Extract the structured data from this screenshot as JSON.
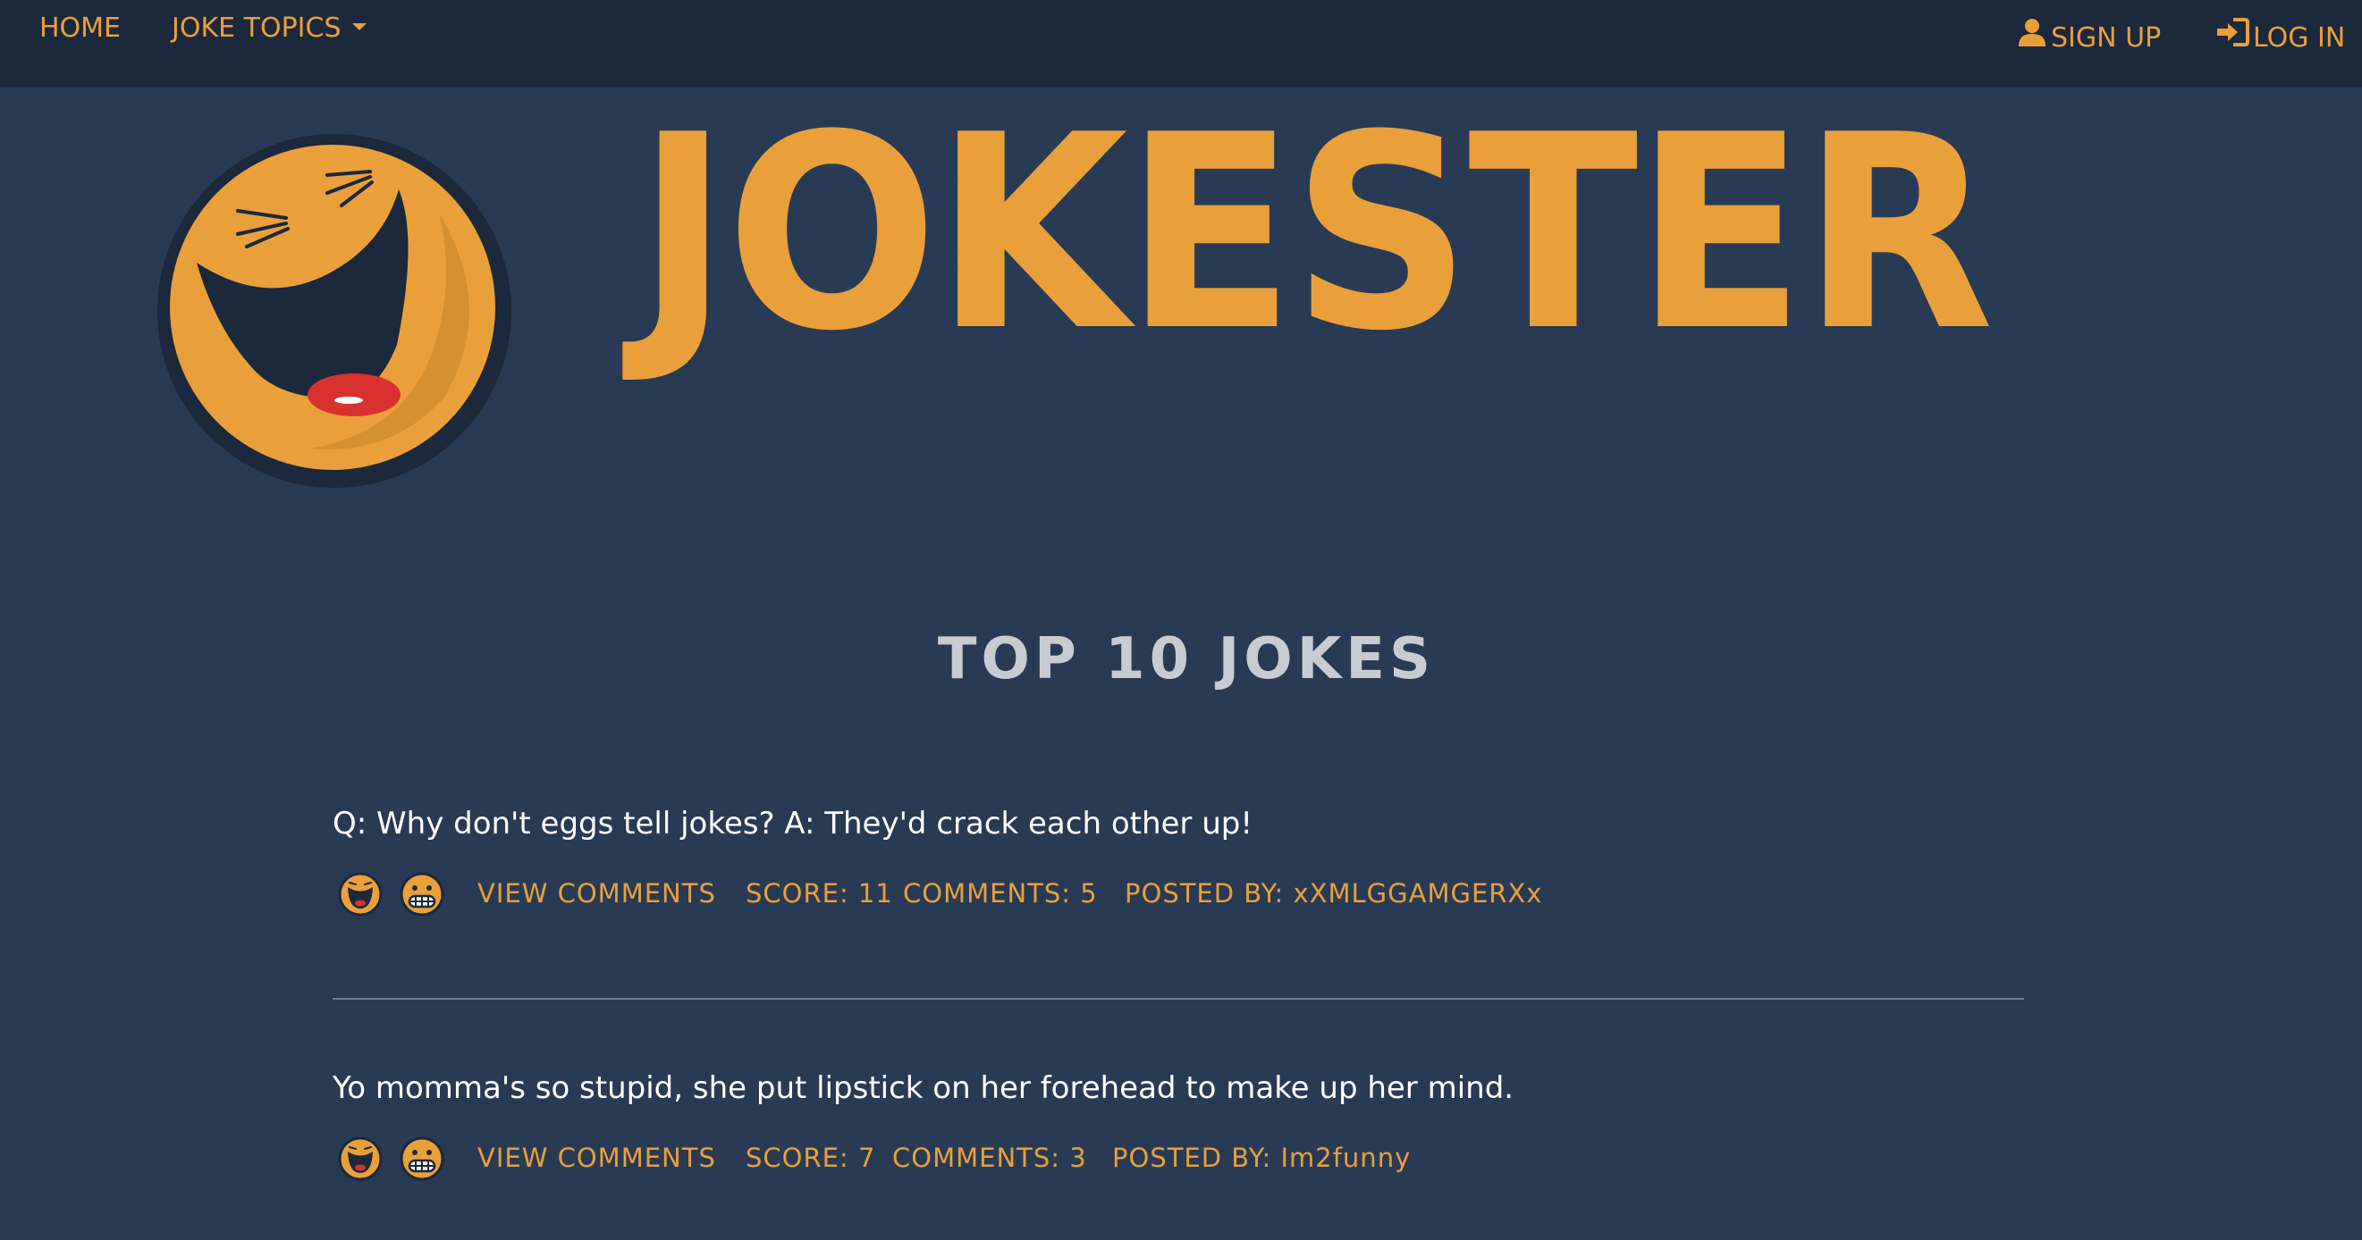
{
  "nav": {
    "home": "HOME",
    "topics": "JOKE TOPICS",
    "signup": "SIGN UP",
    "login": "LOG IN"
  },
  "brand": {
    "title": "JOKESTER"
  },
  "section": {
    "title": "TOP 10 JOKES"
  },
  "jokes": [
    {
      "text": "Q: Why don't eggs tell jokes? A: They'd crack each other up!",
      "view_comments": "VIEW COMMENTS",
      "score": "SCORE: 11",
      "comments": "COMMENTS: 5",
      "posted_by": "POSTED BY: xXMLGGAMGERXx"
    },
    {
      "text": "Yo momma's so stupid, she put lipstick on her forehead to make up her mind.",
      "view_comments": "VIEW COMMENTS",
      "score": "SCORE: 7",
      "comments": "COMMENTS: 3",
      "posted_by": "POSTED BY: Im2funny"
    }
  ],
  "icons": {
    "signup": "user-icon",
    "login": "login-icon",
    "dropdown": "caret-down-icon",
    "upvote": "laughing-face-icon",
    "downvote": "grimace-face-icon",
    "logo": "laughing-face-logo"
  },
  "colors": {
    "accent": "#e9a03a",
    "background": "#293a55",
    "navbar": "#1c283b",
    "title_gray": "#c8ccd2",
    "text": "#ffffff"
  }
}
